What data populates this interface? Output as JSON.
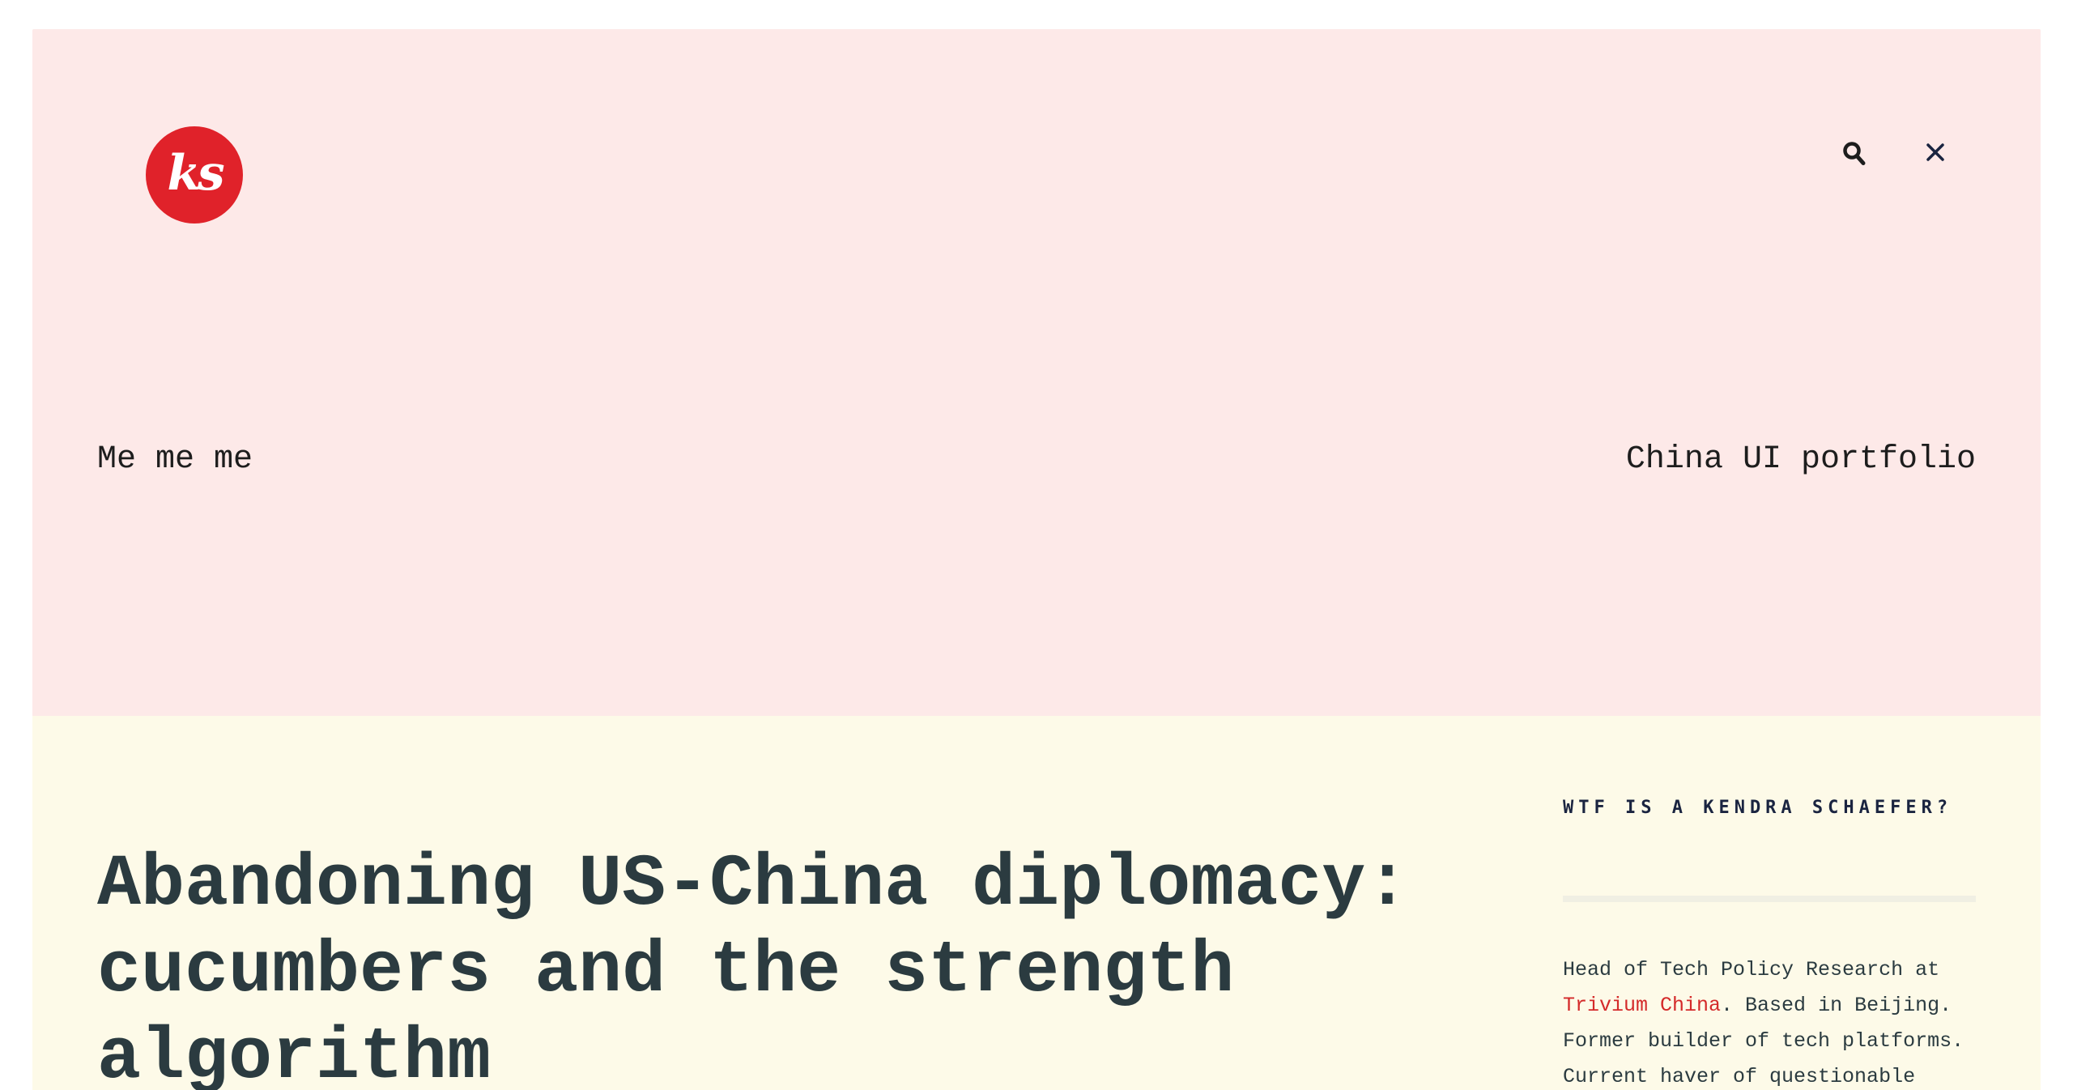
{
  "site": {
    "logo_text": "ks",
    "search_icon": "search-icon",
    "close_icon": "close-icon"
  },
  "nav": {
    "left_link": "Me me me",
    "right_link": "China UI portfolio"
  },
  "post": {
    "title": "Abandoning US-China diplomacy: cucumbers and the strength algorithm"
  },
  "sidebar": {
    "widget_title": "WTF is a Kendra Schaefer?",
    "bio_before_link": "Head of Tech Policy Research at ",
    "bio_link": "Trivium China",
    "bio_after_link": ". Based in Beijing. Former builder of tech platforms. Current haver of questionable ideas."
  },
  "colors": {
    "header_bg": "#fde9e8",
    "main_bg": "#fdfae8",
    "logo_red": "#e0222a",
    "link_red": "#d42a2a",
    "title_ink": "#2b3b40"
  }
}
